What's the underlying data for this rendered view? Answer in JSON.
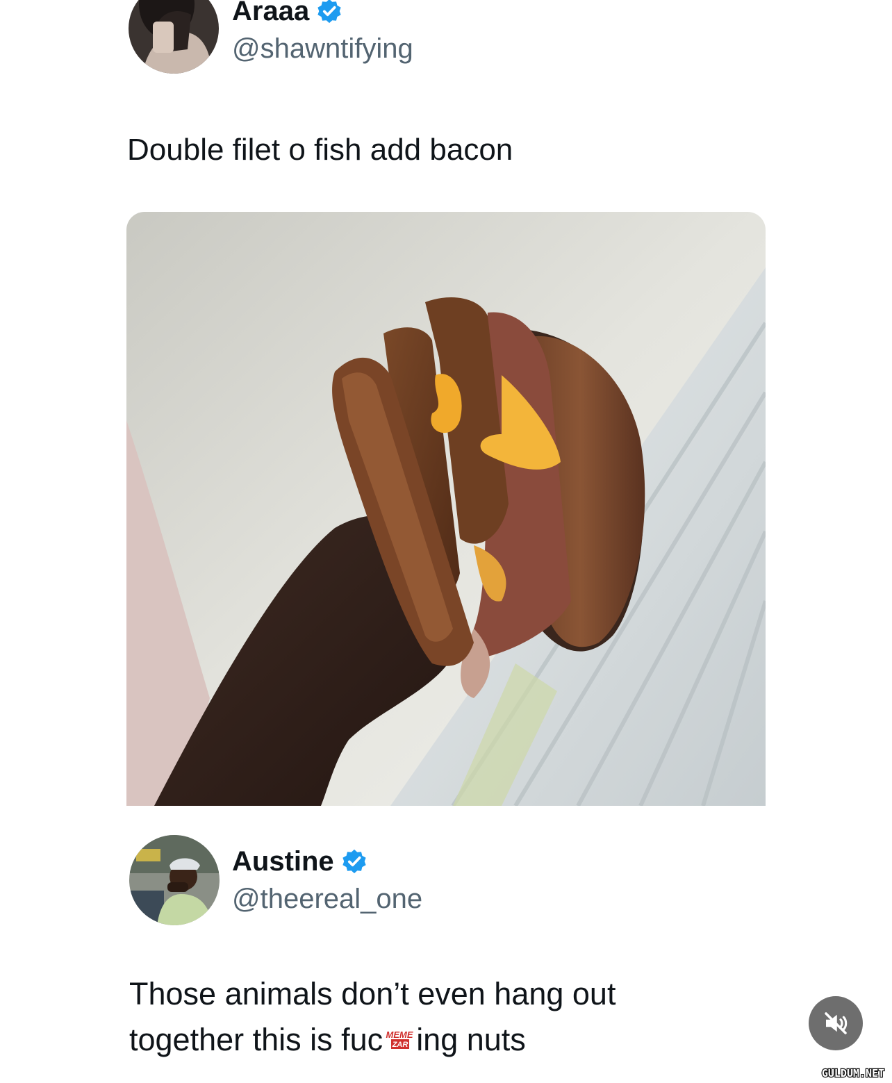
{
  "tweet1": {
    "name": "Araaa",
    "handle": "@shawntifying",
    "text": "Double filet o fish add bacon",
    "verified_color": "#1d9bf0",
    "avatar_icon": "profile-photo",
    "media_icon": "sandwich-photo"
  },
  "tweet2": {
    "name": "Austine",
    "handle": "@theereal_one",
    "text_line1": "Those animals don’t even hang out",
    "text_line2_before": "together this is fuc",
    "text_line2_after": "ing nuts",
    "verified_color": "#1d9bf0",
    "avatar_icon": "profile-photo"
  },
  "overlay": {
    "mute_icon": "speaker-muted-icon",
    "censor_logo_text": "MEME ZAR",
    "watermark_text": "GULDUM.NET"
  },
  "colors": {
    "text_primary": "#0f1419",
    "text_secondary": "#536471",
    "verified": "#1d9bf0"
  }
}
